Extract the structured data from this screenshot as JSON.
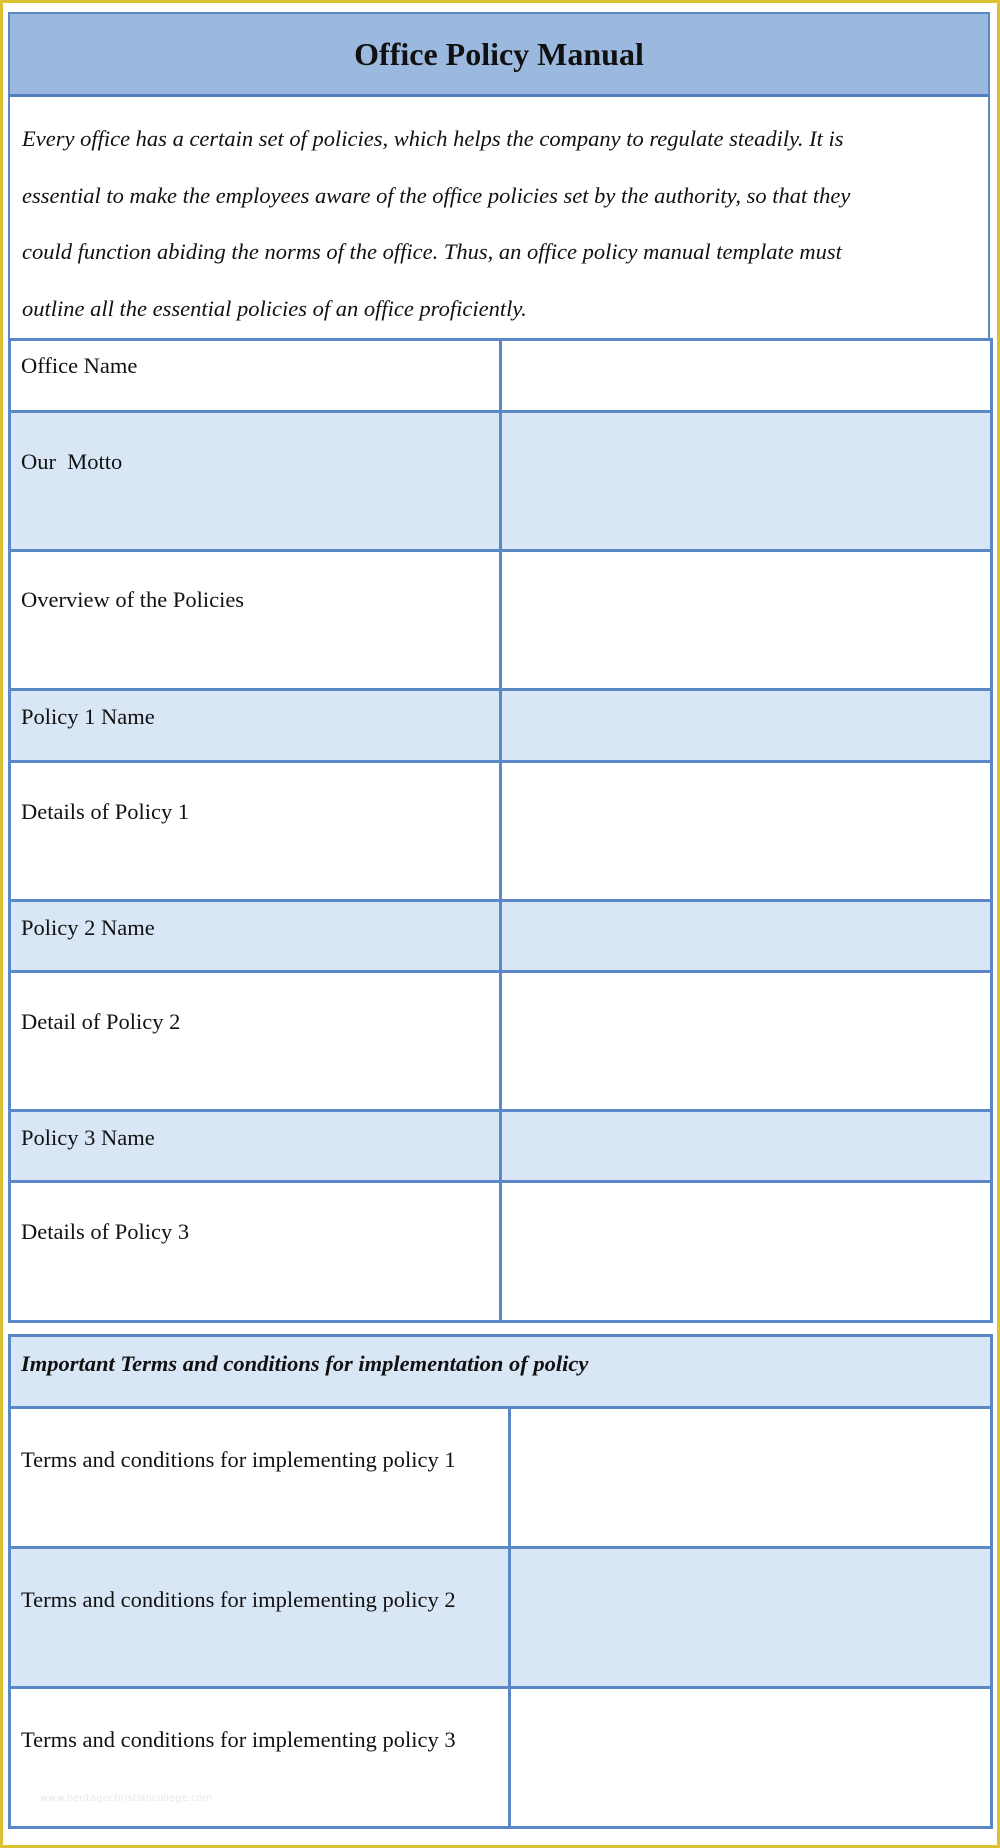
{
  "document": {
    "title": "Office Policy Manual",
    "intro": "Every office has a certain set of policies, which helps the company to regulate steadily. It is essential to make the employees aware of the office policies set by the authority, so that they could function abiding the norms of the office. Thus, an office policy manual template must outline all the essential policies of an office proficiently.",
    "intro_lines": [
      "Every office has a certain set of policies, which helps the company to regulate steadily. It is",
      "essential to make the employees aware of the office policies set by the authority, so that they",
      "could function abiding the norms of the office. Thus, an office policy manual template must",
      "outline all the essential policies of an office proficiently."
    ]
  },
  "policy_table": {
    "rows": [
      {
        "label": "Office Name",
        "value": ""
      },
      {
        "label": "Our  Motto",
        "value": ""
      },
      {
        "label": "Overview of the Policies",
        "value": ""
      },
      {
        "label": "Policy 1 Name",
        "value": ""
      },
      {
        "label": "Details of Policy 1",
        "value": ""
      },
      {
        "label": "Policy 2 Name",
        "value": ""
      },
      {
        "label": "Detail of Policy 2",
        "value": ""
      },
      {
        "label": "Policy 3 Name",
        "value": ""
      },
      {
        "label": "Details of Policy 3",
        "value": ""
      }
    ]
  },
  "terms_table": {
    "header": "Important Terms and conditions for implementation of policy",
    "rows": [
      {
        "label": "Terms and conditions for implementing policy 1",
        "value": ""
      },
      {
        "label": "Terms and conditions for implementing policy 2",
        "value": ""
      },
      {
        "label": "Terms and conditions for implementing policy 3",
        "value": ""
      }
    ]
  },
  "watermark": "www.heritagechristiancollege.com",
  "colors": {
    "page_border": "#dcc233",
    "title_band": "#9bb9df",
    "grid_line": "#5a88c6",
    "row_tint": "#d9e6f6"
  }
}
